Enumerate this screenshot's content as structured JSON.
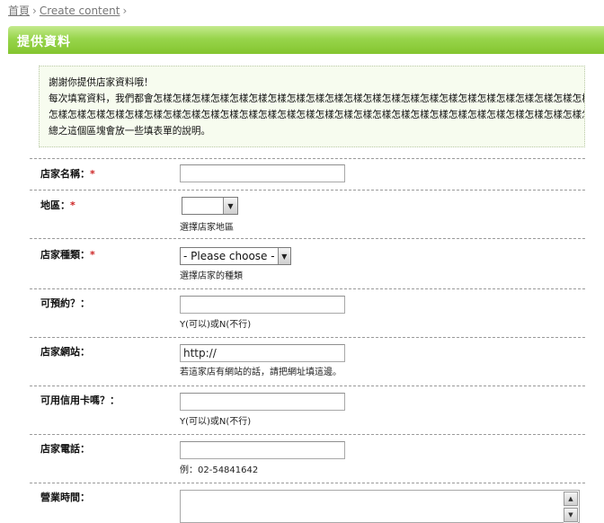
{
  "breadcrumb": {
    "home": "首頁",
    "sep1": "›",
    "current": "Create content",
    "sep2": "›"
  },
  "page": {
    "title": "提供資料"
  },
  "intro": {
    "line1": "謝謝你提供店家資料哦！",
    "line2": "每次填寫資料，我們都會怎樣怎樣怎樣怎樣怎樣怎樣怎樣怎樣怎樣怎樣怎樣怎樣怎樣怎樣怎樣怎樣怎樣怎樣怎樣怎樣怎樣怎樣怎樣怎樣怎樣怎樣怎樣怎樣怎樣怎樣怎樣怎樣怎樣怎樣怎樣怎樣怎樣怎樣怎樣怎樣怎樣怎樣怎樣怎樣怎樣怎樣怎樣怎樣怎樣怎樣怎樣怎樣怎樣怎樣怎樣怎樣怎樣怎樣怎樣怎樣怎樣怎樣怎樣怎樣怎樣怎樣怎樣",
    "line3": "怎樣怎樣怎樣怎樣怎樣怎樣怎樣怎樣怎樣怎樣怎樣怎樣怎樣怎樣怎樣怎樣怎樣怎樣怎樣怎樣怎樣怎樣怎樣怎樣怎樣怎樣怎樣怎樣怎樣，",
    "line4": "總之這個區塊會放一些填表單的說明。"
  },
  "form": {
    "required_mark": "*",
    "shop_name": {
      "label": "店家名稱：",
      "value": ""
    },
    "region": {
      "label": "地區：",
      "selected": "",
      "hint": "選擇店家地區"
    },
    "shop_type": {
      "label": "店家種類：",
      "selected": "- Please choose -",
      "hint": "選擇店家的種類"
    },
    "reservable": {
      "label": "可預約？：",
      "value": "",
      "hint": "Y(可以)或N(不行)"
    },
    "website": {
      "label": "店家網站：",
      "value": "http://",
      "hint": "若這家店有網站的話，請把網址填這邊。"
    },
    "credit_card": {
      "label": "可用信用卡嗎？：",
      "value": "",
      "hint": "Y(可以)或N(不行)"
    },
    "phone": {
      "label": "店家電話：",
      "value": "",
      "hint": "例：02-54841642"
    },
    "hours": {
      "label": "營業時間：",
      "value": ""
    }
  }
}
